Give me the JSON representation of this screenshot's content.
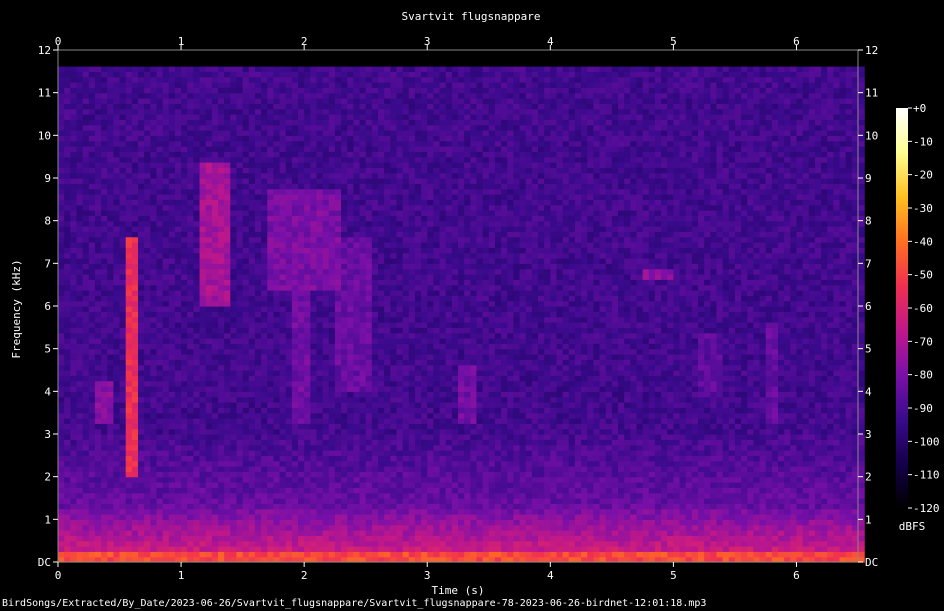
{
  "chart_data": {
    "type": "heatmap",
    "title": "Svartvit flugsnappare",
    "xlabel": "Time (s)",
    "ylabel": "Frequency (kHz)",
    "xlim": [
      0,
      6.5
    ],
    "ylim": [
      0,
      12
    ],
    "x_ticks": [
      "0",
      "1",
      "2",
      "3",
      "4",
      "5",
      "6"
    ],
    "y_ticks": [
      "DC",
      "1",
      "2",
      "3",
      "4",
      "5",
      "6",
      "7",
      "8",
      "9",
      "10",
      "11",
      "12"
    ],
    "colorbar": {
      "unit": "dBFS",
      "range": [
        -120,
        0
      ],
      "ticks": [
        "+0",
        "-10",
        "-20",
        "-30",
        "-40",
        "-50",
        "-60",
        "-70",
        "-80",
        "-90",
        "-100",
        "-110",
        "-120"
      ],
      "colors": [
        "#000000",
        "#14004a",
        "#3a0a8c",
        "#7a10a8",
        "#c0188a",
        "#f03050",
        "#ff7020",
        "#ffc020",
        "#ffff90",
        "#ffffff"
      ]
    },
    "noise_floor_dbfs": -95,
    "noise_ceiling_khz": 11.6,
    "calls": [
      {
        "t_start": 0.55,
        "t_end": 0.58,
        "f_low": 2.0,
        "f_high": 7.6,
        "level_dbfs": -55
      },
      {
        "t_start": 0.33,
        "t_end": 0.36,
        "f_low": 3.2,
        "f_high": 4.2,
        "level_dbfs": -78
      },
      {
        "t_start": 1.18,
        "t_end": 1.35,
        "f_low": 6.0,
        "f_high": 9.3,
        "level_dbfs": -72
      },
      {
        "t_start": 1.75,
        "t_end": 2.2,
        "f_low": 6.3,
        "f_high": 8.7,
        "level_dbfs": -80
      },
      {
        "t_start": 1.95,
        "t_end": 2.0,
        "f_low": 3.2,
        "f_high": 6.5,
        "level_dbfs": -82
      },
      {
        "t_start": 2.3,
        "t_end": 2.45,
        "f_low": 4.0,
        "f_high": 7.5,
        "level_dbfs": -84
      },
      {
        "t_start": 3.28,
        "t_end": 3.32,
        "f_low": 3.2,
        "f_high": 4.6,
        "level_dbfs": -82
      },
      {
        "t_start": 4.75,
        "t_end": 4.92,
        "f_low": 6.55,
        "f_high": 6.75,
        "level_dbfs": -76
      },
      {
        "t_start": 5.2,
        "t_end": 5.3,
        "f_low": 3.8,
        "f_high": 5.3,
        "level_dbfs": -86
      },
      {
        "t_start": 5.75,
        "t_end": 5.79,
        "f_low": 3.2,
        "f_high": 5.6,
        "level_dbfs": -84
      }
    ]
  },
  "footer": {
    "file_path": "BirdSongs/Extracted/By_Date/2023-06-26/Svartvit_flugsnappare/Svartvit_flugsnappare-78-2023-06-26-birdnet-12:01:18.mp3"
  }
}
